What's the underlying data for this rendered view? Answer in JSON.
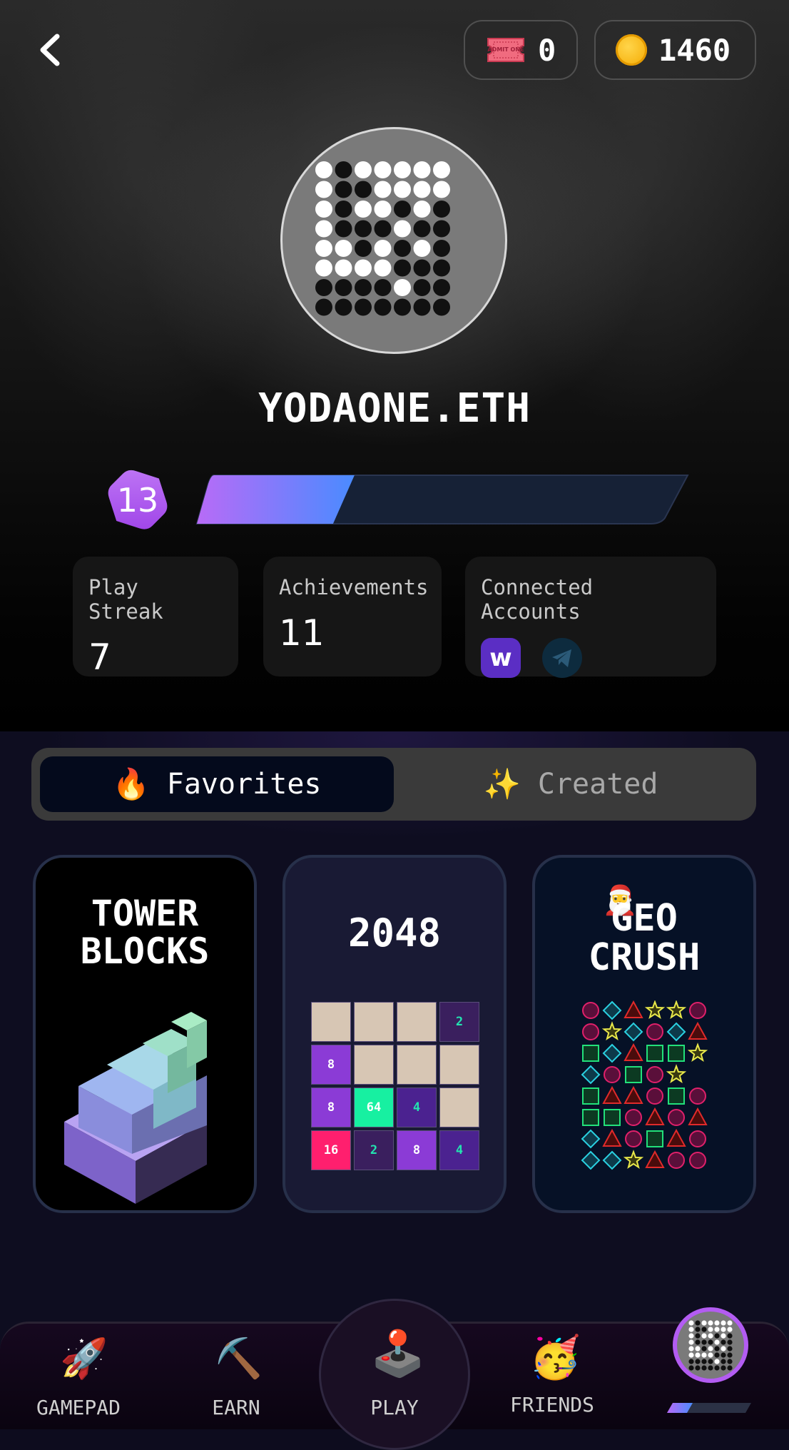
{
  "header": {
    "tickets": {
      "count": "0",
      "icon": "ticket-icon",
      "ticket_text": "ADMIT ONE"
    },
    "coins": {
      "count": "1460",
      "icon": "coin-icon"
    }
  },
  "profile": {
    "username": "YODAONE.ETH",
    "level": "13",
    "xp_progress": 0.28
  },
  "stats": {
    "play_streak": {
      "label": "Play Streak",
      "value": "7"
    },
    "achievements": {
      "label": "Achievements",
      "value": "11"
    },
    "connected_accounts": {
      "label": "Connected Accounts",
      "accounts": [
        "w",
        "telegram-icon"
      ]
    }
  },
  "tabs": {
    "favorites": {
      "label": "Favorites",
      "icon": "fire-icon"
    },
    "created": {
      "label": "Created",
      "icon": "sparkles-icon"
    }
  },
  "games": [
    {
      "title_line1": "TOWER",
      "title_line2": "BLOCKS"
    },
    {
      "title": "2048",
      "grid": [
        [
          "",
          "",
          "",
          "2"
        ],
        [
          "8",
          "",
          "",
          ""
        ],
        [
          "8",
          "64",
          "4",
          ""
        ],
        [
          "16",
          "2",
          "8",
          "4"
        ]
      ]
    },
    {
      "title_line1": "GEO",
      "title_line2": "CRUSH"
    }
  ],
  "nav": {
    "gamepad": "GAMEPAD",
    "earn": "EARN",
    "play": "PLAY",
    "friends": "FRIENDS"
  },
  "colors": {
    "accent_purple": "#b35cf2",
    "xp_gradient_start": "#b86bf7",
    "xp_gradient_end": "#4a8bff"
  }
}
